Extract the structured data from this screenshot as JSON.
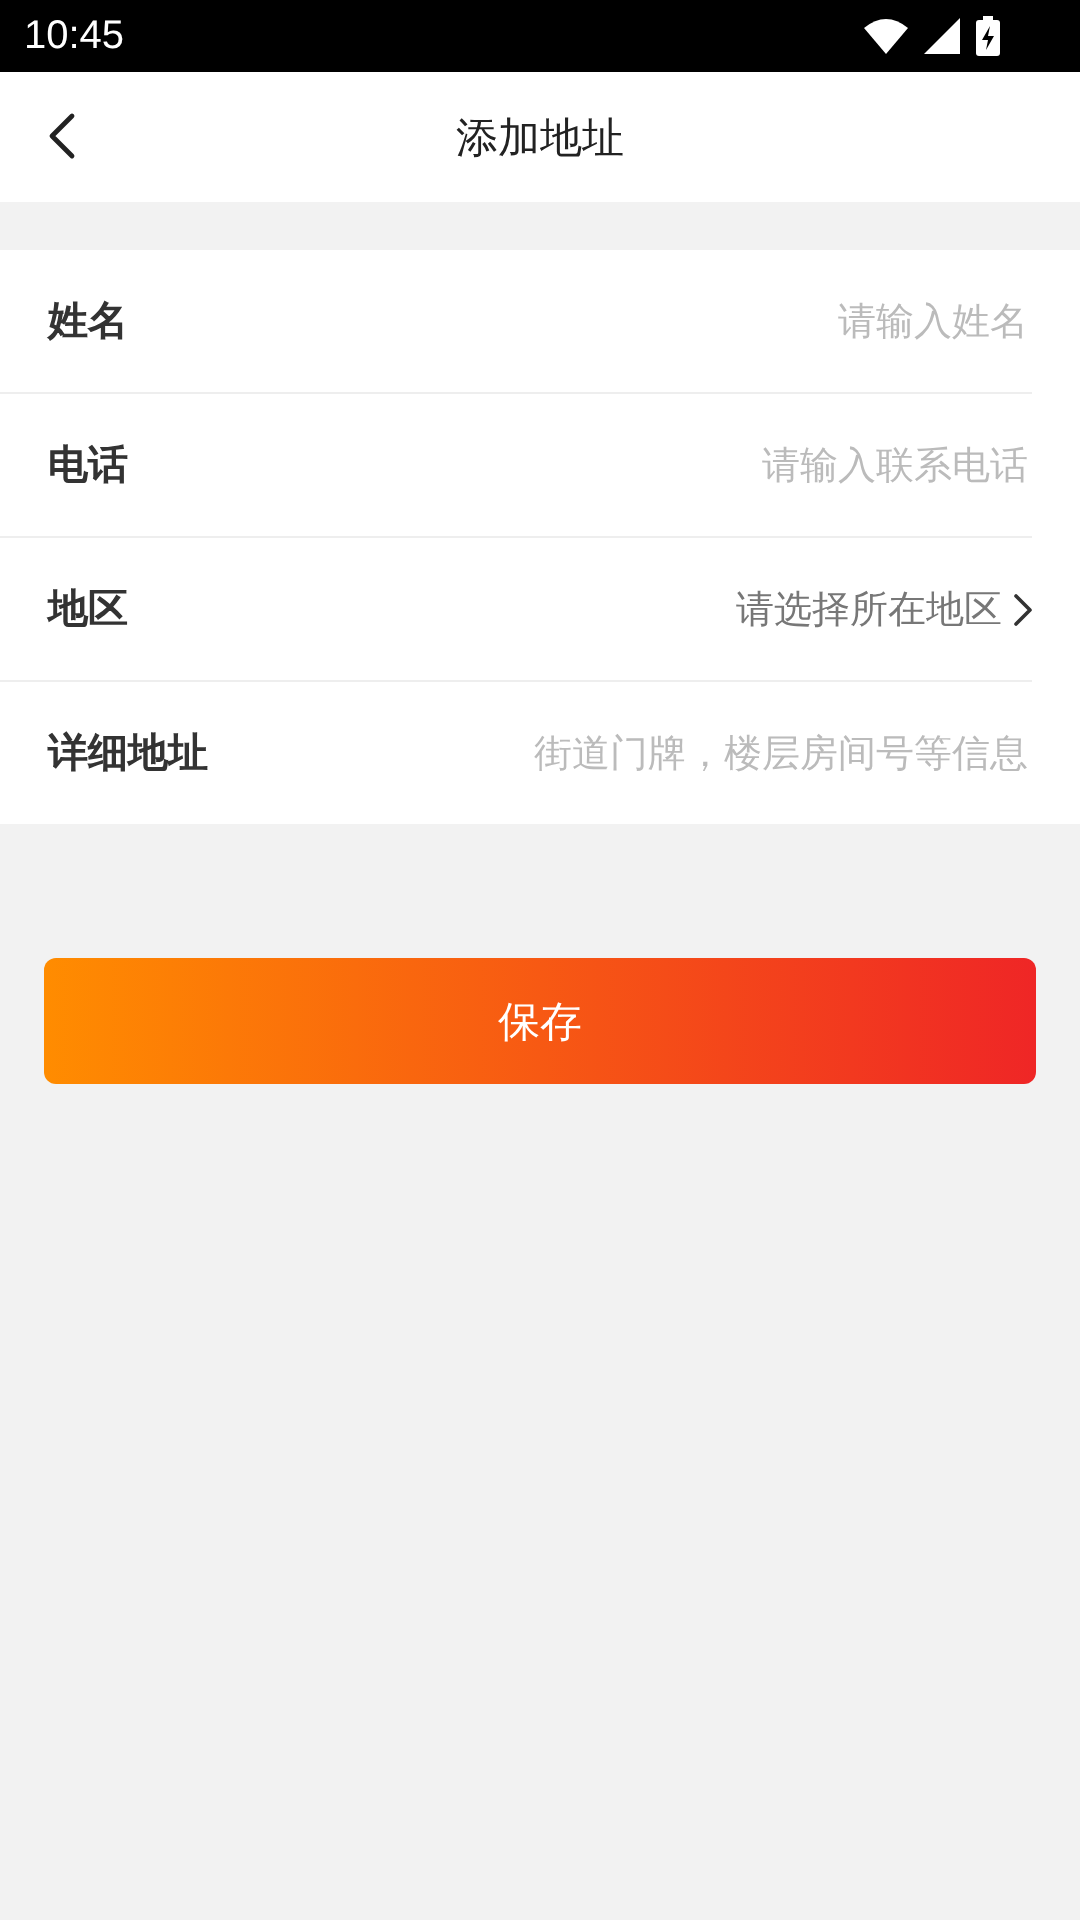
{
  "status_bar": {
    "time": "10:45"
  },
  "header": {
    "title": "添加地址"
  },
  "form": {
    "rows": [
      {
        "kind": "input",
        "label": "姓名",
        "placeholder": "请输入姓名"
      },
      {
        "kind": "input",
        "label": "电话",
        "placeholder": "请输入联系电话"
      },
      {
        "kind": "select",
        "label": "地区",
        "value": "请选择所在地区"
      },
      {
        "kind": "input",
        "label": "详细地址",
        "placeholder": "街道门牌，楼层房间号等信息"
      }
    ]
  },
  "save_button": {
    "label": "保存"
  }
}
